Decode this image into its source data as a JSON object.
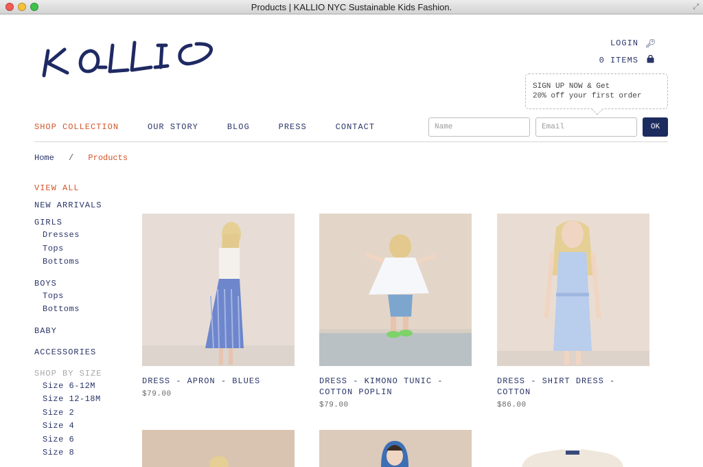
{
  "window": {
    "title": "Products | KALLIO NYC Sustainable Kids Fashion."
  },
  "brand": {
    "logo_text": "KALLIO"
  },
  "account": {
    "login_label": "LOGIN",
    "cart_label": "0 ITEMS"
  },
  "promo": {
    "line1": "SIGN UP NOW & Get",
    "line2": "20% off your first order"
  },
  "nav": {
    "items": [
      {
        "label": "SHOP COLLECTION"
      },
      {
        "label": "OUR STORY"
      },
      {
        "label": "BLOG"
      },
      {
        "label": "PRESS"
      },
      {
        "label": "CONTACT"
      }
    ]
  },
  "signup": {
    "name_placeholder": "Name",
    "email_placeholder": "Email",
    "submit_label": "OK"
  },
  "breadcrumb": {
    "home": "Home",
    "separator": "/",
    "current": "Products"
  },
  "sidebar": {
    "view_all": "VIEW ALL",
    "new_arrivals": "NEW ARRIVALS",
    "girls": {
      "label": "GIRLS",
      "items": [
        "Dresses",
        "Tops",
        "Bottoms"
      ]
    },
    "boys": {
      "label": "BOYS",
      "items": [
        "Tops",
        "Bottoms"
      ]
    },
    "baby": "BABY",
    "accessories": "ACCESSORIES",
    "size": {
      "label": "SHOP BY SIZE",
      "items": [
        "Size 6-12M",
        "Size 12-18M",
        "Size 2",
        "Size 4",
        "Size 6",
        "Size 8"
      ]
    }
  },
  "products": [
    {
      "name_line1": "DRESS - APRON - BLUES",
      "name_line2": "",
      "price": "$79.00"
    },
    {
      "name_line1": "DRESS - KIMONO TUNIC -",
      "name_line2": "COTTON POPLIN",
      "price": "$79.00"
    },
    {
      "name_line1": "DRESS - SHIRT DRESS -",
      "name_line2": "COTTON",
      "price": "$86.00"
    }
  ],
  "colors": {
    "navy": "#2a3568",
    "accent": "#d2552a",
    "button": "#1d2c5e"
  }
}
